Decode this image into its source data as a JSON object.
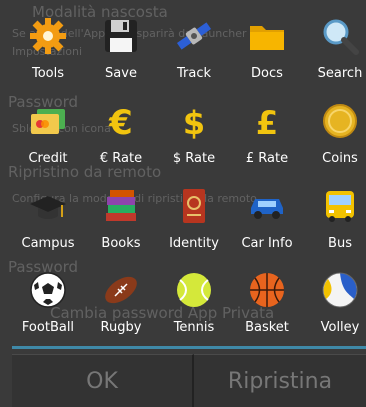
{
  "background_text": [
    "Modalità nascosta",
    "Se attivi dell'App, rive sparirà dal launcher",
    "Impostazioni",
    "Password",
    "Sblocca con icona",
    "Ripristino da remoto",
    "Configura la modalità di ripristino da remoto",
    "Password",
    "Cambia password App Privata"
  ],
  "grid": [
    {
      "label": "Tools",
      "icon": "tools-gear-icon"
    },
    {
      "label": "Save",
      "icon": "floppy-disk-icon"
    },
    {
      "label": "Track",
      "icon": "satellite-icon"
    },
    {
      "label": "Docs",
      "icon": "folder-icon"
    },
    {
      "label": "Search",
      "icon": "magnifier-icon"
    },
    {
      "label": "Credit",
      "icon": "credit-card-icon"
    },
    {
      "label": "€ Rate",
      "icon": "euro-icon"
    },
    {
      "label": "$ Rate",
      "icon": "dollar-icon"
    },
    {
      "label": "£ Rate",
      "icon": "pound-icon"
    },
    {
      "label": "Coins",
      "icon": "coin-icon"
    },
    {
      "label": "Campus",
      "icon": "graduation-cap-icon"
    },
    {
      "label": "Books",
      "icon": "books-icon"
    },
    {
      "label": "Identity",
      "icon": "passport-icon"
    },
    {
      "label": "Car Info",
      "icon": "car-icon"
    },
    {
      "label": "Bus",
      "icon": "bus-icon"
    },
    {
      "label": "FootBall",
      "icon": "soccer-ball-icon"
    },
    {
      "label": "Rugby",
      "icon": "rugby-ball-icon"
    },
    {
      "label": "Tennis",
      "icon": "tennis-ball-icon"
    },
    {
      "label": "Basket",
      "icon": "basketball-icon"
    },
    {
      "label": "Volley",
      "icon": "volleyball-icon"
    }
  ],
  "buttons": {
    "ok": "OK",
    "restore": "Ripristina"
  }
}
